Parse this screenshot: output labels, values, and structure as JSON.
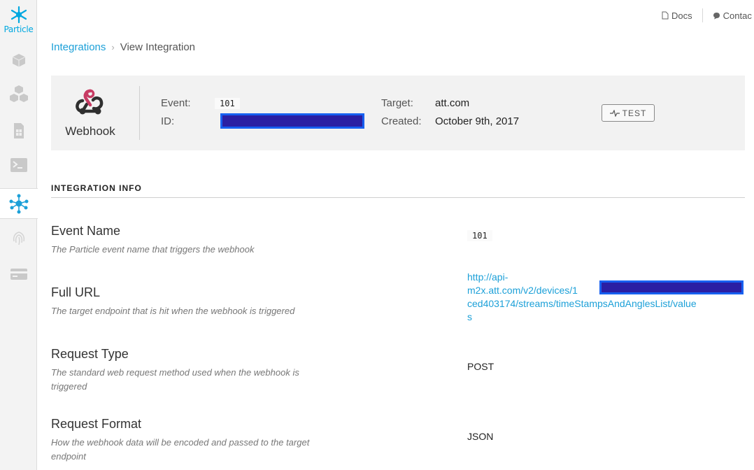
{
  "brand": {
    "name": "Particle",
    "accent": "#00a8e0"
  },
  "sidebar": {
    "items": [
      {
        "icon": "cube-icon",
        "active": false
      },
      {
        "icon": "cubes-icon",
        "active": false
      },
      {
        "icon": "sim-card-icon",
        "active": false
      },
      {
        "icon": "console-icon",
        "active": false
      },
      {
        "icon": "integrations-icon",
        "active": true
      },
      {
        "icon": "fingerprint-icon",
        "active": false
      },
      {
        "icon": "credit-card-icon",
        "active": false
      }
    ]
  },
  "toplinks": {
    "docs": "Docs",
    "contact": "Contac"
  },
  "breadcrumb": {
    "parent": "Integrations",
    "current": "View Integration"
  },
  "integration": {
    "type": "Webhook",
    "event_label": "Event:",
    "event_value": "101",
    "id_label": "ID:",
    "target_label": "Target:",
    "target_value": "att.com",
    "created_label": "Created:",
    "created_value": "October 9th, 2017",
    "test_label": "TEST"
  },
  "info": {
    "section_title": "INTEGRATION INFO",
    "rows": [
      {
        "name": "Event Name",
        "desc": "The Particle event name that triggers the webhook",
        "value": "101"
      },
      {
        "name": "Full URL",
        "desc": "The target endpoint that is hit when the webhook is triggered",
        "value_line1": "http://api-",
        "value_line2": "m2x.att.com/v2/devices/1",
        "value_line3": "ced403174/streams/timeStampsAndAnglesList/value",
        "value_line4": "s"
      },
      {
        "name": "Request Type",
        "desc": "The standard web request method used when the webhook is triggered",
        "value": "POST"
      },
      {
        "name": "Request Format",
        "desc": "How the webhook data will be encoded and passed to the target endpoint",
        "value": "JSON"
      }
    ]
  }
}
